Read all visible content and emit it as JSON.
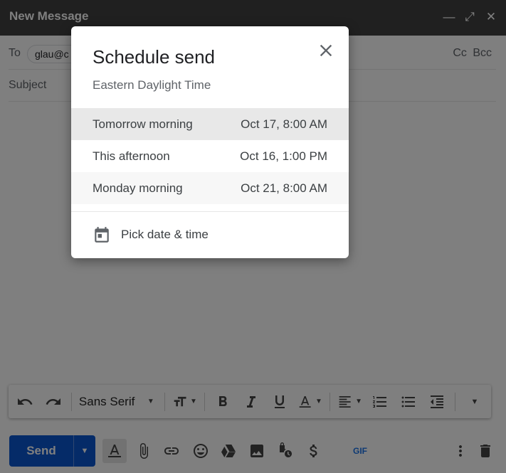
{
  "compose": {
    "title": "New Message",
    "to_label": "To",
    "recipient": "glau@c",
    "cc_label": "Cc",
    "bcc_label": "Bcc",
    "subject_placeholder": "Subject",
    "font_name": "Sans Serif",
    "send_label": "Send",
    "gif_label": "GIF"
  },
  "dialog": {
    "title": "Schedule send",
    "timezone": "Eastern Daylight Time",
    "options": [
      {
        "label": "Tomorrow morning",
        "when": "Oct 17, 8:00 AM"
      },
      {
        "label": "This afternoon",
        "when": "Oct 16, 1:00 PM"
      },
      {
        "label": "Monday morning",
        "when": "Oct 21, 8:00 AM"
      }
    ],
    "pick_label": "Pick date & time"
  }
}
